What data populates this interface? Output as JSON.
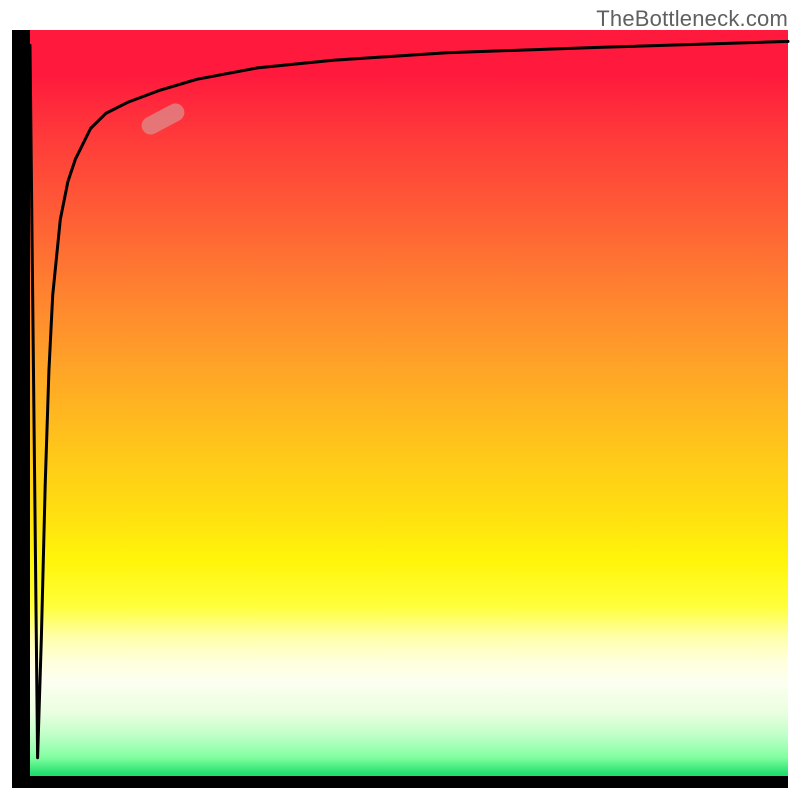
{
  "attribution": "TheBottleneck.com",
  "colors": {
    "axis": "#000000",
    "curve": "#000000",
    "marker": "rgba(220,140,140,0.75)",
    "attribution_text": "#606060",
    "gradient_top": "#ff1a3d",
    "gradient_mid": "#ffe010",
    "gradient_bottom": "#00d060"
  },
  "marker": {
    "x_frac": 0.175,
    "y_frac": 0.118,
    "angle_deg": -28
  },
  "chart_data": {
    "type": "line",
    "title": "",
    "xlabel": "",
    "ylabel": "",
    "xlim": [
      0,
      1
    ],
    "ylim": [
      0,
      1
    ],
    "legend": false,
    "grid": false,
    "annotations": [
      {
        "text": "TheBottleneck.com",
        "position": "top-right"
      }
    ],
    "series": [
      {
        "name": "bottleneck-curve",
        "x": [
          0.0,
          0.01,
          0.015,
          0.02,
          0.025,
          0.03,
          0.04,
          0.05,
          0.06,
          0.08,
          0.1,
          0.13,
          0.17,
          0.22,
          0.3,
          0.4,
          0.55,
          0.75,
          1.0
        ],
        "y": [
          0.98,
          0.04,
          0.2,
          0.4,
          0.55,
          0.65,
          0.75,
          0.8,
          0.83,
          0.87,
          0.89,
          0.905,
          0.92,
          0.935,
          0.95,
          0.96,
          0.97,
          0.977,
          0.985
        ]
      }
    ],
    "background_gradient": {
      "direction": "top-to-bottom",
      "stops": [
        {
          "pos": 0.0,
          "color": "#ff1a3d"
        },
        {
          "pos": 0.5,
          "color": "#ffc21c"
        },
        {
          "pos": 0.8,
          "color": "#ffffa8"
        },
        {
          "pos": 1.0,
          "color": "#00d060"
        }
      ]
    },
    "marker_segment": {
      "x_center_frac": 0.175,
      "y_center_frac": 0.882,
      "orientation_deg_from_horizontal": 28
    }
  }
}
